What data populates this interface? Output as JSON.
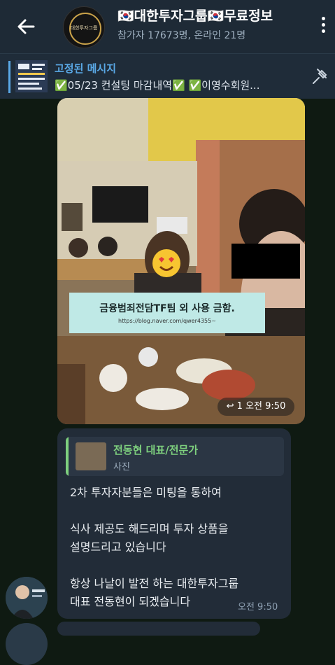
{
  "header": {
    "title": "🇰🇷대한투자그룹🇰🇷무료정보",
    "subtitle": "참가자 17673명, 온라인 21명",
    "avatar_text": "대한투자그룹",
    "back_icon": "arrow-left-icon",
    "menu_icon": "more-vertical-icon"
  },
  "pinned": {
    "label": "고정된 메시지",
    "text": "✅05/23 컨설팅 마감내역✅ ✅이영수회원...",
    "pin_icon": "pin-off-icon"
  },
  "photo_message": {
    "watermark_title": "금융범죄전담TF팀 외 사용 금함.",
    "watermark_url": "https://blog.naver.com/qwer4355~",
    "replies": "↩ 1",
    "time": "오전 9:50"
  },
  "text_message": {
    "reply_name": "전동현 대표/전문가",
    "reply_type": "사진",
    "lines": [
      "2차 투자자분들은 미팅을 통하여",
      "식사 제공도 해드리며 투자 상품을",
      "설명드리고 있습니다",
      "항상 나날이 발전 하는 대한투자그룹",
      "대표 전동현이 되겠습니다"
    ],
    "time": "오전 9:50"
  },
  "colors": {
    "header_bg": "#1e2a36",
    "accent_blue": "#5aa9e6",
    "reply_green": "#7ed07e",
    "bubble_bg": "#222c38",
    "chat_bg": "#0f1a12"
  }
}
